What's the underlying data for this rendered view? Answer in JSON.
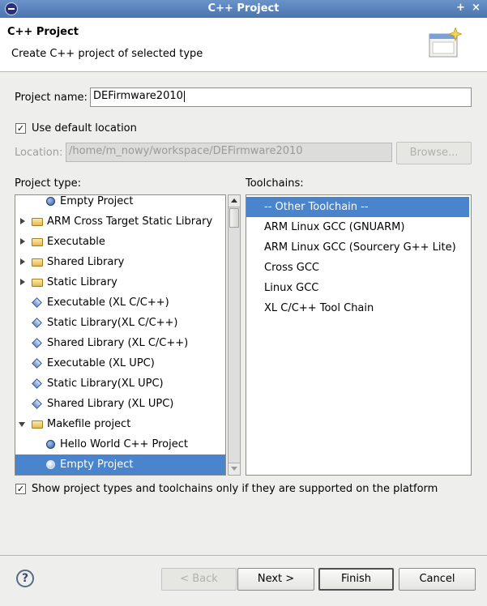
{
  "window": {
    "title": "C++ Project",
    "controls": [
      "+",
      "×"
    ]
  },
  "header": {
    "title": "C++ Project",
    "description": "Create C++ project of selected type"
  },
  "project_name": {
    "label": "Project name:",
    "value": "DEFirmware2010"
  },
  "default_location": {
    "label": "Use default location",
    "checked": true
  },
  "location": {
    "label": "Location:",
    "value": "/home/m_nowy/workspace/DEFirmware2010",
    "browse_label": "Browse..."
  },
  "project_type": {
    "label": "Project type:",
    "items": [
      {
        "label": "Empty Project",
        "icon": "project-dot-icon",
        "expander": "none",
        "selected": false
      },
      {
        "label": "ARM Cross Target Static Library",
        "icon": "folder-icon",
        "expander": "collapsed",
        "selected": false
      },
      {
        "label": "Executable",
        "icon": "folder-icon",
        "expander": "collapsed",
        "selected": false
      },
      {
        "label": "Shared Library",
        "icon": "folder-icon",
        "expander": "collapsed",
        "selected": false
      },
      {
        "label": "Static Library",
        "icon": "folder-icon",
        "expander": "collapsed",
        "selected": false
      },
      {
        "label": "Executable (XL C/C++)",
        "icon": "diamond-icon",
        "expander": "none",
        "selected": false
      },
      {
        "label": "Static Library(XL C/C++)",
        "icon": "diamond-icon",
        "expander": "none",
        "selected": false
      },
      {
        "label": "Shared Library (XL C/C++)",
        "icon": "diamond-icon",
        "expander": "none",
        "selected": false
      },
      {
        "label": "Executable (XL UPC)",
        "icon": "diamond-icon",
        "expander": "none",
        "selected": false
      },
      {
        "label": "Static Library(XL UPC)",
        "icon": "diamond-icon",
        "expander": "none",
        "selected": false
      },
      {
        "label": "Shared Library (XL UPC)",
        "icon": "diamond-icon",
        "expander": "none",
        "selected": false
      },
      {
        "label": "Makefile project",
        "icon": "folder-icon",
        "expander": "expanded",
        "selected": false
      },
      {
        "label": "Hello World C++ Project",
        "icon": "project-dot-icon",
        "expander": "none",
        "selected": false
      },
      {
        "label": "Empty Project",
        "icon": "project-dot-icon",
        "expander": "none",
        "selected": true
      }
    ]
  },
  "toolchains": {
    "label": "Toolchains:",
    "items": [
      {
        "label": "-- Other Toolchain --",
        "selected": true
      },
      {
        "label": "ARM Linux GCC (GNUARM)",
        "selected": false
      },
      {
        "label": "ARM Linux GCC (Sourcery G++ Lite)",
        "selected": false
      },
      {
        "label": "Cross GCC",
        "selected": false
      },
      {
        "label": "Linux GCC",
        "selected": false
      },
      {
        "label": "XL C/C++ Tool Chain",
        "selected": false
      }
    ]
  },
  "show_supported": {
    "label": "Show project types and toolchains only if they are supported on the platform",
    "checked": true
  },
  "buttons": {
    "back": "< Back",
    "next": "Next >",
    "finish": "Finish",
    "cancel": "Cancel",
    "help": "?"
  },
  "colors": {
    "selection": "#4a84cc",
    "titlebar": "#4a74b0"
  }
}
